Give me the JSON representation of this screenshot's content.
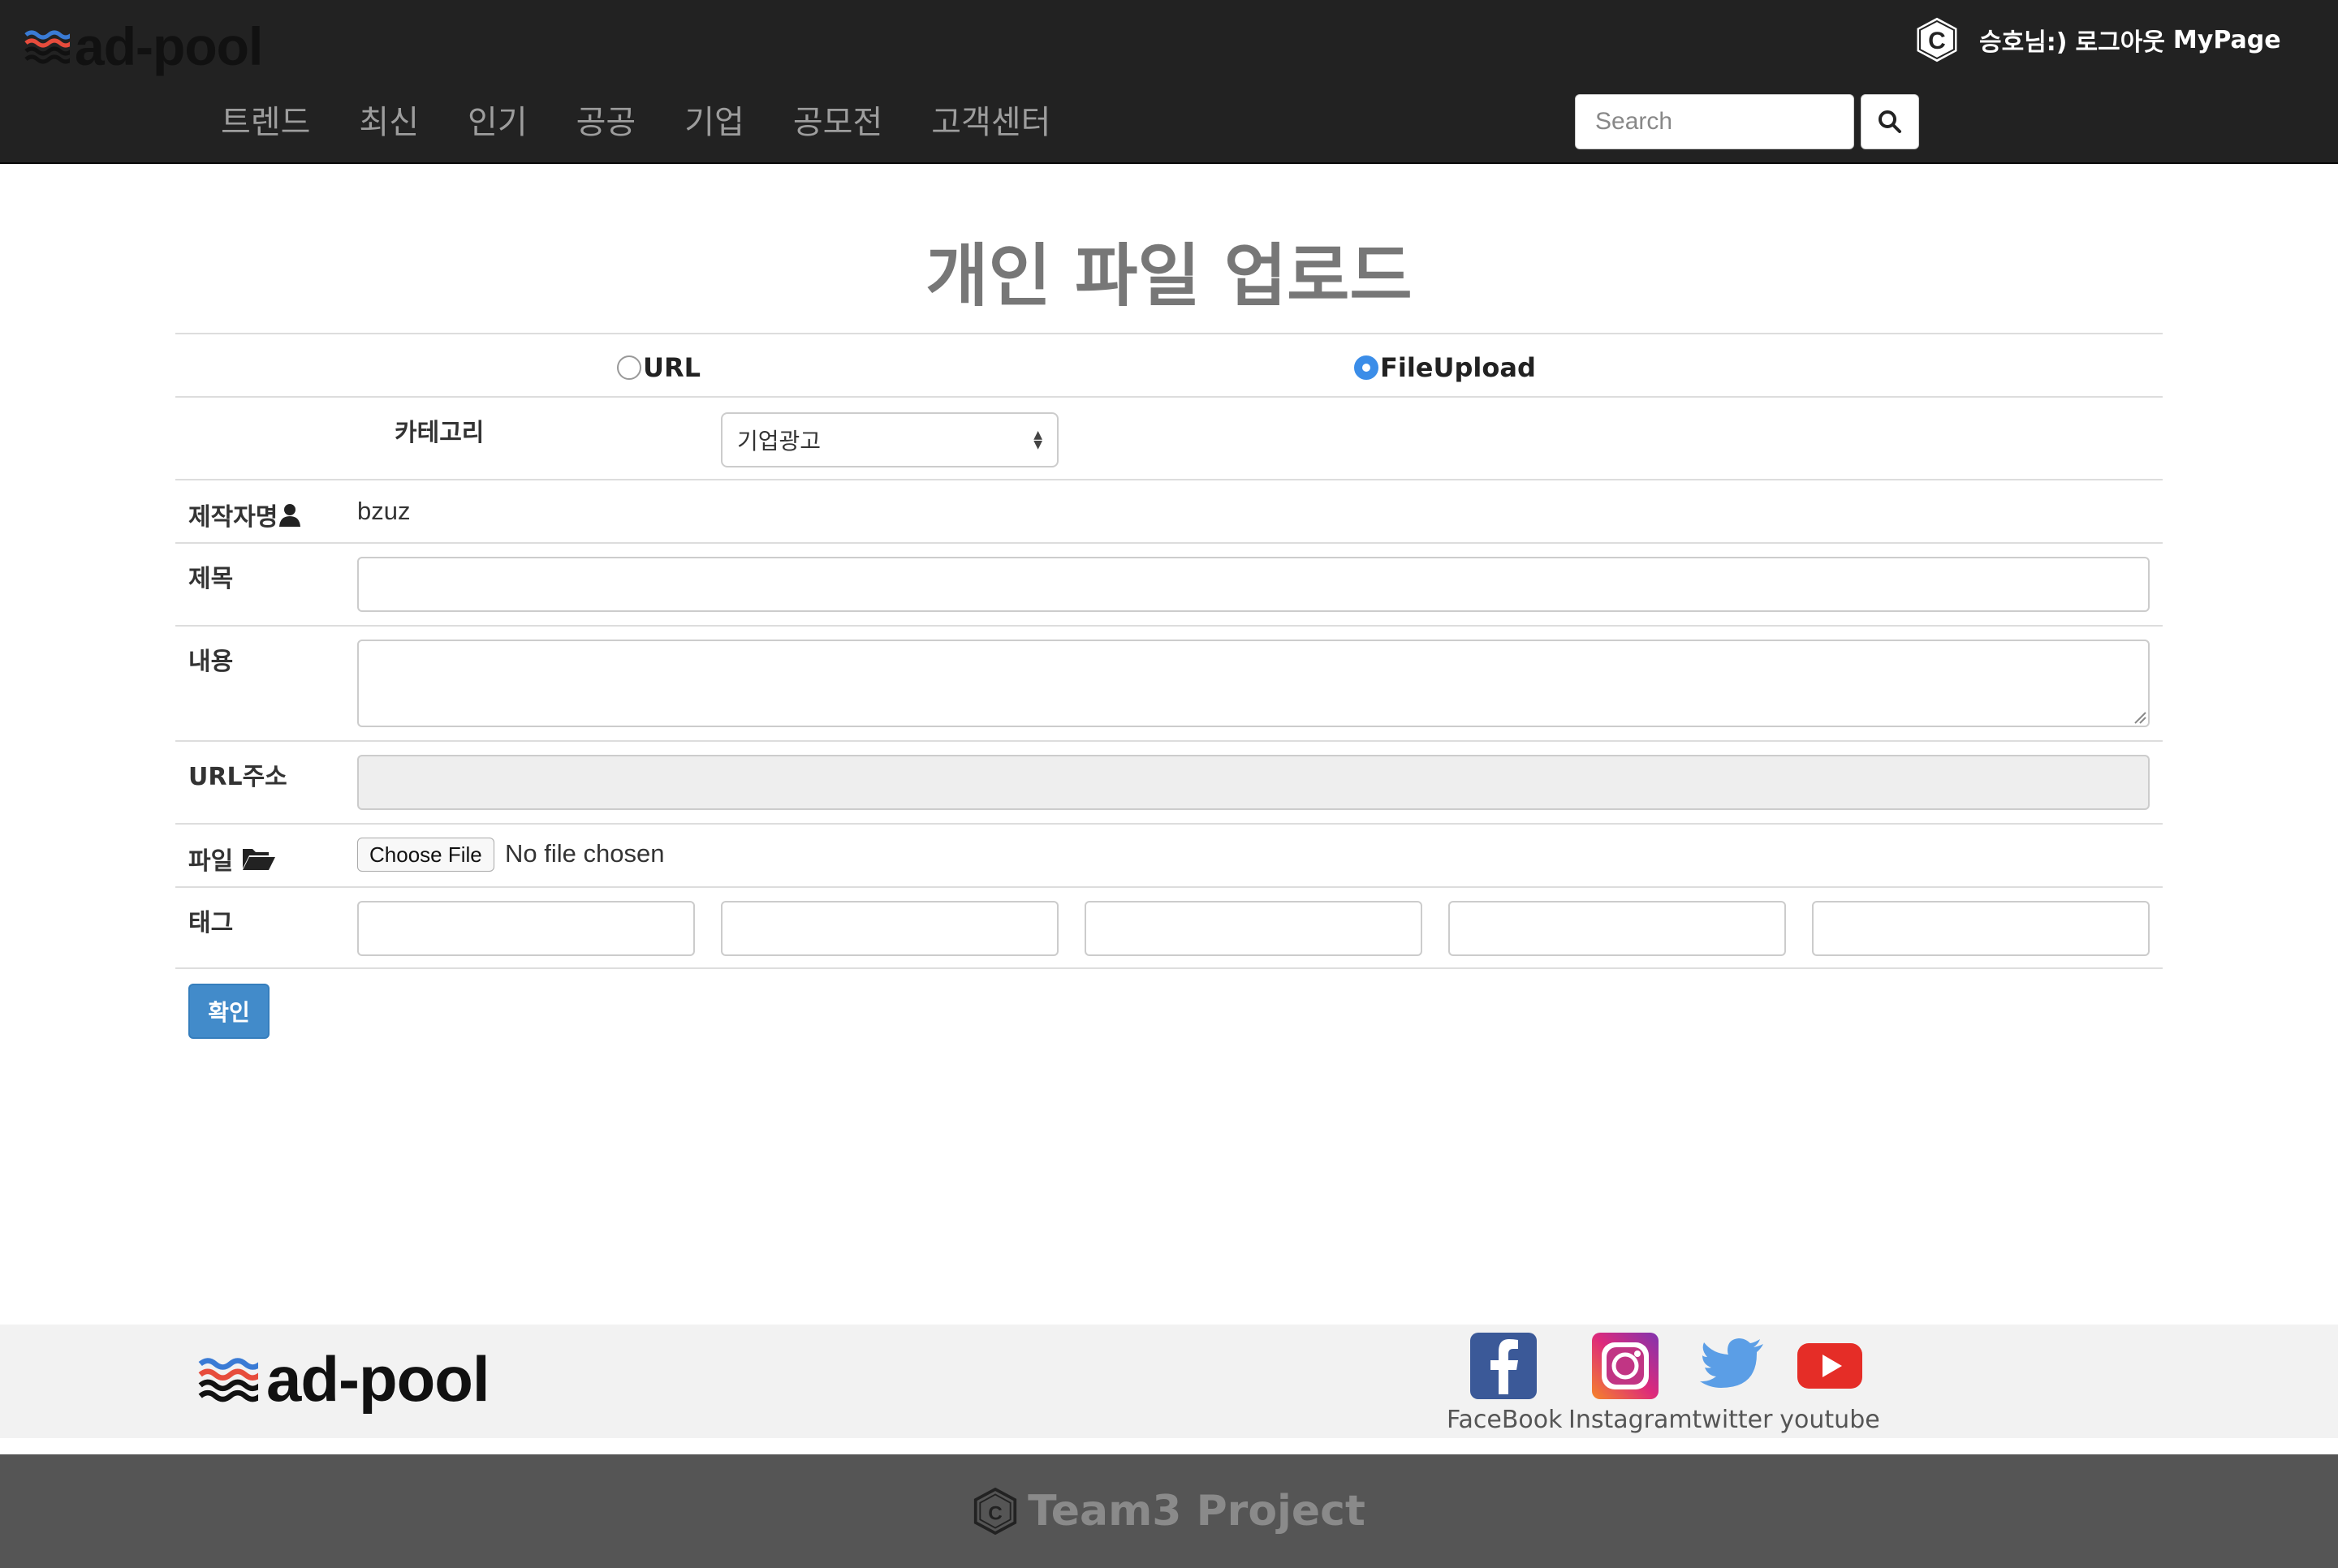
{
  "header": {
    "logo_text": "ad-pool",
    "nav": [
      "트렌드",
      "최신",
      "인기",
      "공공",
      "기업",
      "공모전",
      "고객센터"
    ],
    "search_placeholder": "Search",
    "user_greeting": "승호님:)",
    "logout": "로그아웃",
    "mypage": "MyPage"
  },
  "page": {
    "title": "개인 파일 업로드"
  },
  "form": {
    "upload_type_options": [
      {
        "label": "URL",
        "checked": false
      },
      {
        "label": "FileUpload",
        "checked": true
      }
    ],
    "category_label": "카테고리",
    "category_selected": "기업광고",
    "author_label": "제작자명",
    "author_value": "bzuz",
    "title_label": "제목",
    "title_value": "",
    "content_label": "내용",
    "content_value": "",
    "url_label": "URL주소",
    "url_value": "",
    "url_disabled": true,
    "file_label": "파일",
    "file_button": "Choose File",
    "file_status": "No file chosen",
    "tag_label": "태그",
    "tags": [
      "",
      "",
      "",
      "",
      ""
    ],
    "submit_label": "확인"
  },
  "footer": {
    "logo_text": "ad-pool",
    "social": [
      {
        "label": "FaceBook",
        "icon": "facebook-icon",
        "color": "#3b5998"
      },
      {
        "label": "Instagram",
        "icon": "instagram-icon",
        "color": "#c13584"
      },
      {
        "label": "twitter",
        "icon": "twitter-icon",
        "color": "#55acee"
      },
      {
        "label": "youtube",
        "icon": "youtube-icon",
        "color": "#e52d27"
      }
    ],
    "copyright": "Team3 Project"
  },
  "colors": {
    "header_bg": "#222222",
    "nav_text": "#9d9d9d",
    "primary_button": "#428bca",
    "footer_bg": "#f2f2f2",
    "bottom_bar_bg": "#555555"
  }
}
